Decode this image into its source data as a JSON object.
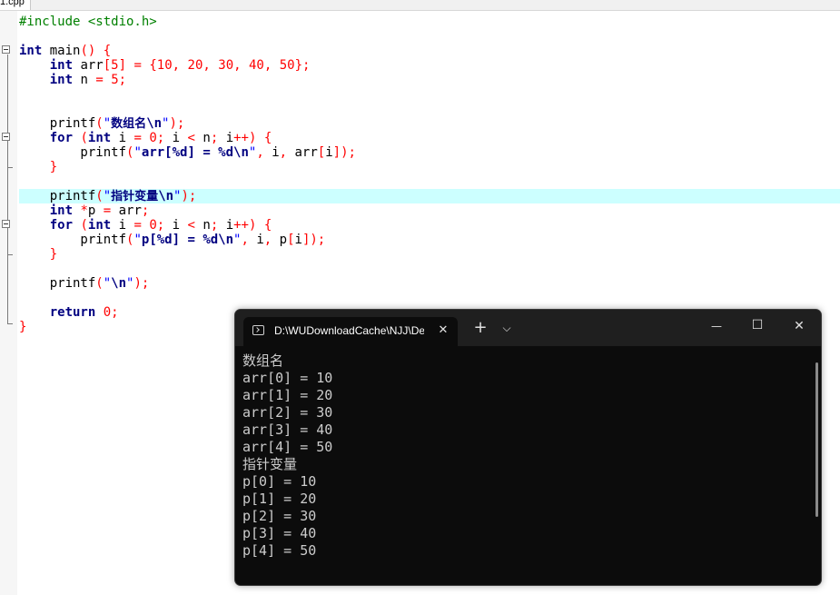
{
  "editor": {
    "tab_label": "1.cpp",
    "lines": [
      {
        "row": 0,
        "tokens": [
          {
            "t": "pp",
            "v": "#include <stdio.h>"
          }
        ]
      },
      {
        "row": 2,
        "tokens": [
          {
            "t": "kw",
            "v": "int"
          },
          {
            "t": "pl",
            "v": " main"
          },
          {
            "t": "op",
            "v": "()"
          },
          {
            "t": "pl",
            "v": " "
          },
          {
            "t": "op",
            "v": "{"
          }
        ]
      },
      {
        "row": 3,
        "tokens": [
          {
            "t": "pl",
            "v": "    "
          },
          {
            "t": "kw",
            "v": "int"
          },
          {
            "t": "pl",
            "v": " arr"
          },
          {
            "t": "op",
            "v": "["
          },
          {
            "t": "num",
            "v": "5"
          },
          {
            "t": "op",
            "v": "]"
          },
          {
            "t": "pl",
            "v": " "
          },
          {
            "t": "op",
            "v": "="
          },
          {
            "t": "pl",
            "v": " "
          },
          {
            "t": "op",
            "v": "{"
          },
          {
            "t": "num",
            "v": "10"
          },
          {
            "t": "op",
            "v": ","
          },
          {
            "t": "pl",
            "v": " "
          },
          {
            "t": "num",
            "v": "20"
          },
          {
            "t": "op",
            "v": ","
          },
          {
            "t": "pl",
            "v": " "
          },
          {
            "t": "num",
            "v": "30"
          },
          {
            "t": "op",
            "v": ","
          },
          {
            "t": "pl",
            "v": " "
          },
          {
            "t": "num",
            "v": "40"
          },
          {
            "t": "op",
            "v": ","
          },
          {
            "t": "pl",
            "v": " "
          },
          {
            "t": "num",
            "v": "50"
          },
          {
            "t": "op",
            "v": "};"
          }
        ]
      },
      {
        "row": 4,
        "tokens": [
          {
            "t": "pl",
            "v": "    "
          },
          {
            "t": "kw",
            "v": "int"
          },
          {
            "t": "pl",
            "v": " n "
          },
          {
            "t": "op",
            "v": "="
          },
          {
            "t": "pl",
            "v": " "
          },
          {
            "t": "num",
            "v": "5"
          },
          {
            "t": "op",
            "v": ";"
          }
        ]
      },
      {
        "row": 7,
        "tokens": [
          {
            "t": "pl",
            "v": "    printf"
          },
          {
            "t": "op",
            "v": "("
          },
          {
            "t": "str",
            "v": "\""
          },
          {
            "t": "cjk",
            "v": "数组名"
          },
          {
            "t": "esc",
            "v": "\\n"
          },
          {
            "t": "str",
            "v": "\""
          },
          {
            "t": "op",
            "v": ");"
          }
        ]
      },
      {
        "row": 8,
        "tokens": [
          {
            "t": "pl",
            "v": "    "
          },
          {
            "t": "kw",
            "v": "for"
          },
          {
            "t": "pl",
            "v": " "
          },
          {
            "t": "op",
            "v": "("
          },
          {
            "t": "kw",
            "v": "int"
          },
          {
            "t": "pl",
            "v": " i "
          },
          {
            "t": "op",
            "v": "="
          },
          {
            "t": "pl",
            "v": " "
          },
          {
            "t": "num",
            "v": "0"
          },
          {
            "t": "op",
            "v": ";"
          },
          {
            "t": "pl",
            "v": " i "
          },
          {
            "t": "op",
            "v": "<"
          },
          {
            "t": "pl",
            "v": " n"
          },
          {
            "t": "op",
            "v": ";"
          },
          {
            "t": "pl",
            "v": " i"
          },
          {
            "t": "op",
            "v": "++)"
          },
          {
            "t": "pl",
            "v": " "
          },
          {
            "t": "op",
            "v": "{"
          }
        ]
      },
      {
        "row": 9,
        "tokens": [
          {
            "t": "pl",
            "v": "        printf"
          },
          {
            "t": "op",
            "v": "("
          },
          {
            "t": "str",
            "v": "\""
          },
          {
            "t": "esc",
            "v": "arr[%d] = %d\\n"
          },
          {
            "t": "str",
            "v": "\""
          },
          {
            "t": "op",
            "v": ","
          },
          {
            "t": "pl",
            "v": " i"
          },
          {
            "t": "op",
            "v": ","
          },
          {
            "t": "pl",
            "v": " arr"
          },
          {
            "t": "op",
            "v": "["
          },
          {
            "t": "pl",
            "v": "i"
          },
          {
            "t": "op",
            "v": "]);"
          }
        ]
      },
      {
        "row": 10,
        "tokens": [
          {
            "t": "pl",
            "v": "    "
          },
          {
            "t": "op",
            "v": "}"
          }
        ]
      },
      {
        "row": 12,
        "tokens": [
          {
            "t": "pl",
            "v": "    printf"
          },
          {
            "t": "op",
            "v": "("
          },
          {
            "t": "str",
            "v": "\""
          },
          {
            "t": "cjk",
            "v": "指针变量"
          },
          {
            "t": "esc",
            "v": "\\n"
          },
          {
            "t": "str",
            "v": "\""
          },
          {
            "t": "op",
            "v": ");"
          }
        ]
      },
      {
        "row": 13,
        "tokens": [
          {
            "t": "pl",
            "v": "    "
          },
          {
            "t": "kw",
            "v": "int"
          },
          {
            "t": "pl",
            "v": " "
          },
          {
            "t": "op",
            "v": "*"
          },
          {
            "t": "pl",
            "v": "p "
          },
          {
            "t": "op",
            "v": "="
          },
          {
            "t": "pl",
            "v": " arr"
          },
          {
            "t": "op",
            "v": ";"
          }
        ]
      },
      {
        "row": 14,
        "tokens": [
          {
            "t": "pl",
            "v": "    "
          },
          {
            "t": "kw",
            "v": "for"
          },
          {
            "t": "pl",
            "v": " "
          },
          {
            "t": "op",
            "v": "("
          },
          {
            "t": "kw",
            "v": "int"
          },
          {
            "t": "pl",
            "v": " i "
          },
          {
            "t": "op",
            "v": "="
          },
          {
            "t": "pl",
            "v": " "
          },
          {
            "t": "num",
            "v": "0"
          },
          {
            "t": "op",
            "v": ";"
          },
          {
            "t": "pl",
            "v": " i "
          },
          {
            "t": "op",
            "v": "<"
          },
          {
            "t": "pl",
            "v": " n"
          },
          {
            "t": "op",
            "v": ";"
          },
          {
            "t": "pl",
            "v": " i"
          },
          {
            "t": "op",
            "v": "++)"
          },
          {
            "t": "pl",
            "v": " "
          },
          {
            "t": "op",
            "v": "{"
          }
        ]
      },
      {
        "row": 15,
        "tokens": [
          {
            "t": "pl",
            "v": "        printf"
          },
          {
            "t": "op",
            "v": "("
          },
          {
            "t": "str",
            "v": "\""
          },
          {
            "t": "esc",
            "v": "p[%d] = %d\\n"
          },
          {
            "t": "str",
            "v": "\""
          },
          {
            "t": "op",
            "v": ","
          },
          {
            "t": "pl",
            "v": " i"
          },
          {
            "t": "op",
            "v": ","
          },
          {
            "t": "pl",
            "v": " p"
          },
          {
            "t": "op",
            "v": "["
          },
          {
            "t": "pl",
            "v": "i"
          },
          {
            "t": "op",
            "v": "]);"
          }
        ]
      },
      {
        "row": 16,
        "tokens": [
          {
            "t": "pl",
            "v": "    "
          },
          {
            "t": "op",
            "v": "}"
          }
        ]
      },
      {
        "row": 18,
        "tokens": [
          {
            "t": "pl",
            "v": "    printf"
          },
          {
            "t": "op",
            "v": "("
          },
          {
            "t": "str",
            "v": "\""
          },
          {
            "t": "esc",
            "v": "\\n"
          },
          {
            "t": "str",
            "v": "\""
          },
          {
            "t": "op",
            "v": ");"
          }
        ]
      },
      {
        "row": 20,
        "tokens": [
          {
            "t": "pl",
            "v": "    "
          },
          {
            "t": "kw",
            "v": "return"
          },
          {
            "t": "pl",
            "v": " "
          },
          {
            "t": "num",
            "v": "0"
          },
          {
            "t": "op",
            "v": ";"
          }
        ]
      },
      {
        "row": 21,
        "tokens": [
          {
            "t": "op",
            "v": "}"
          }
        ]
      }
    ],
    "highlighted_row": 12
  },
  "terminal": {
    "tab_title": "D:\\WUDownloadCache\\NJJ\\Dev",
    "new_tab_glyph": "+",
    "dropdown_glyph": "⌵",
    "close_tab_glyph": "✕",
    "minimize_glyph": "—",
    "maximize_glyph": "☐",
    "close_glyph": "✕",
    "output": [
      "数组名",
      "arr[0] = 10",
      "arr[1] = 20",
      "arr[2] = 30",
      "arr[3] = 40",
      "arr[4] = 50",
      "指针变量",
      "p[0] = 10",
      "p[1] = 20",
      "p[2] = 30",
      "p[3] = 40",
      "p[4] = 50"
    ]
  }
}
